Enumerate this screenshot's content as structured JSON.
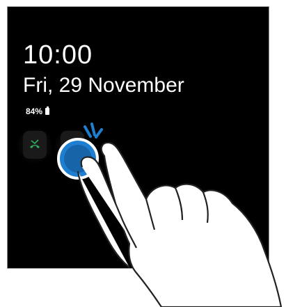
{
  "lock_screen": {
    "time": "10:00",
    "date": "Fri, 29 November",
    "battery_percent": "84%"
  },
  "notifications": [
    {
      "icon": "missed-call-icon",
      "color": "#2fae5f"
    },
    {
      "icon": "message-icon",
      "color": "#1e86e0"
    }
  ],
  "colors": {
    "screen_bg": "#000000",
    "tap_indicator": "#1e7fd0",
    "hand_outline": "#222222"
  }
}
